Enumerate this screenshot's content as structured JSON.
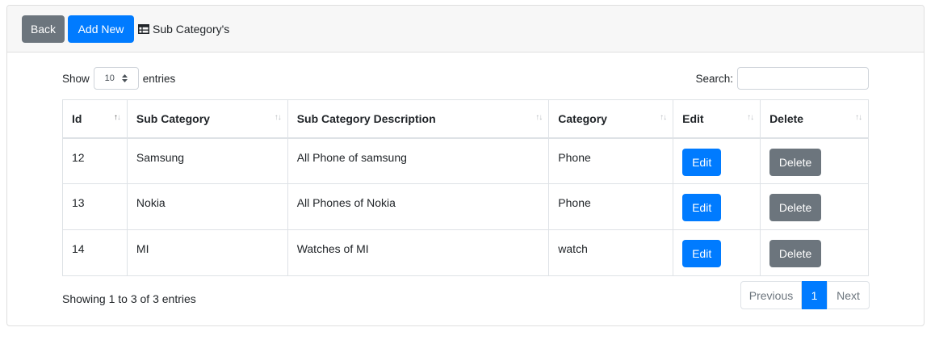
{
  "header": {
    "back_label": "Back",
    "add_label": "Add New",
    "title": "Sub Category's",
    "icon": "table-icon"
  },
  "controls": {
    "show_label": "Show",
    "entries_value": "10",
    "entries_label": "entries",
    "search_label": "Search:",
    "search_value": ""
  },
  "table": {
    "columns": [
      "Id",
      "Sub Category",
      "Sub Category Description",
      "Category",
      "Edit",
      "Delete"
    ],
    "rows": [
      {
        "id": "12",
        "sub_category": "Samsung",
        "description": "All Phone of samsung",
        "category": "Phone",
        "edit_label": "Edit",
        "delete_label": "Delete"
      },
      {
        "id": "13",
        "sub_category": "Nokia",
        "description": "All Phones of Nokia",
        "category": "Phone",
        "edit_label": "Edit",
        "delete_label": "Delete"
      },
      {
        "id": "14",
        "sub_category": "MI",
        "description": "Watches of MI",
        "category": "watch",
        "edit_label": "Edit",
        "delete_label": "Delete"
      }
    ]
  },
  "footer": {
    "info": "Showing 1 to 3 of 3 entries",
    "previous_label": "Previous",
    "current_page": "1",
    "next_label": "Next"
  },
  "colors": {
    "primary": "#007bff",
    "secondary": "#6c757d"
  }
}
